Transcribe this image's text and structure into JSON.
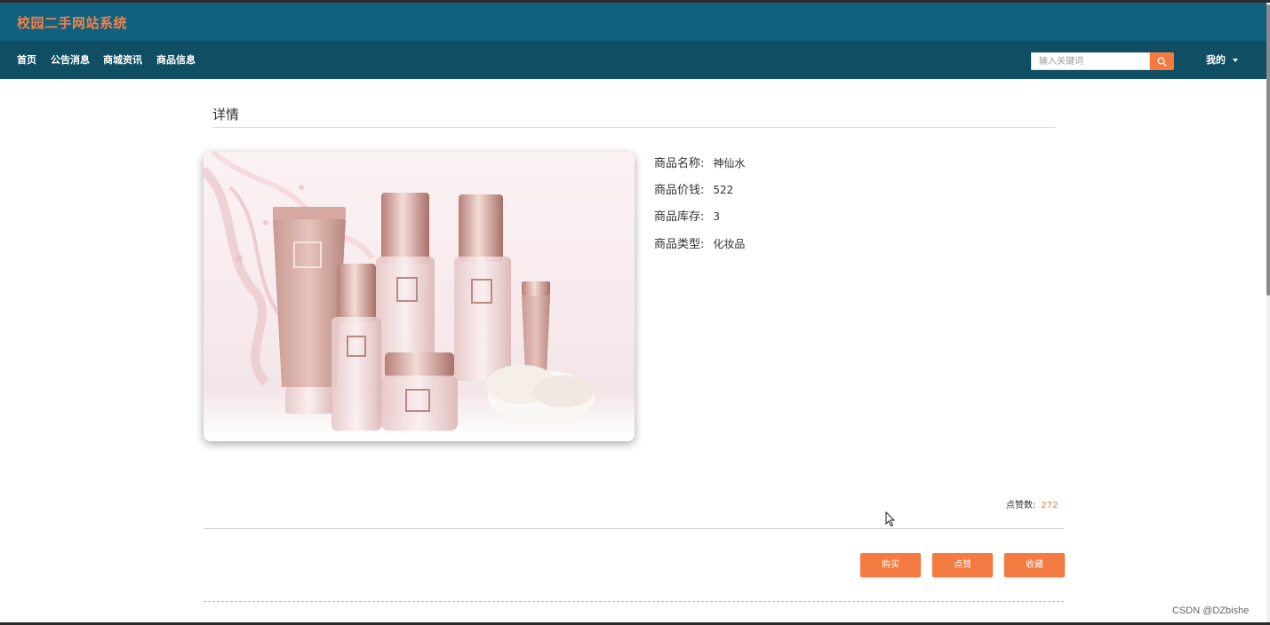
{
  "header": {
    "site_title": "校园二手网站系统"
  },
  "nav": {
    "items": [
      {
        "label": "首页"
      },
      {
        "label": "公告消息"
      },
      {
        "label": "商城资讯"
      },
      {
        "label": "商品信息"
      }
    ],
    "search_placeholder": "输入关键词",
    "search_icon": "search-icon",
    "user_menu_label": "我的",
    "user_menu_icon": "caret-down-icon"
  },
  "detail": {
    "section_title": "详情",
    "image_alt": "cosmetics-product-photo",
    "fields": [
      {
        "label": "商品名称:",
        "value": "神仙水"
      },
      {
        "label": "商品价钱:",
        "value": "522"
      },
      {
        "label": "商品库存:",
        "value": "3"
      },
      {
        "label": "商品类型:",
        "value": "化妆品"
      }
    ],
    "likes_label": "点赞数:",
    "likes_count": "272"
  },
  "actions": {
    "buy": "购买",
    "like": "点赞",
    "favorite": "收藏"
  },
  "watermark": "CSDN @DZbishe",
  "colors": {
    "topbar": "#10617d",
    "navbar": "#0f4e63",
    "accent": "#f37a40"
  }
}
